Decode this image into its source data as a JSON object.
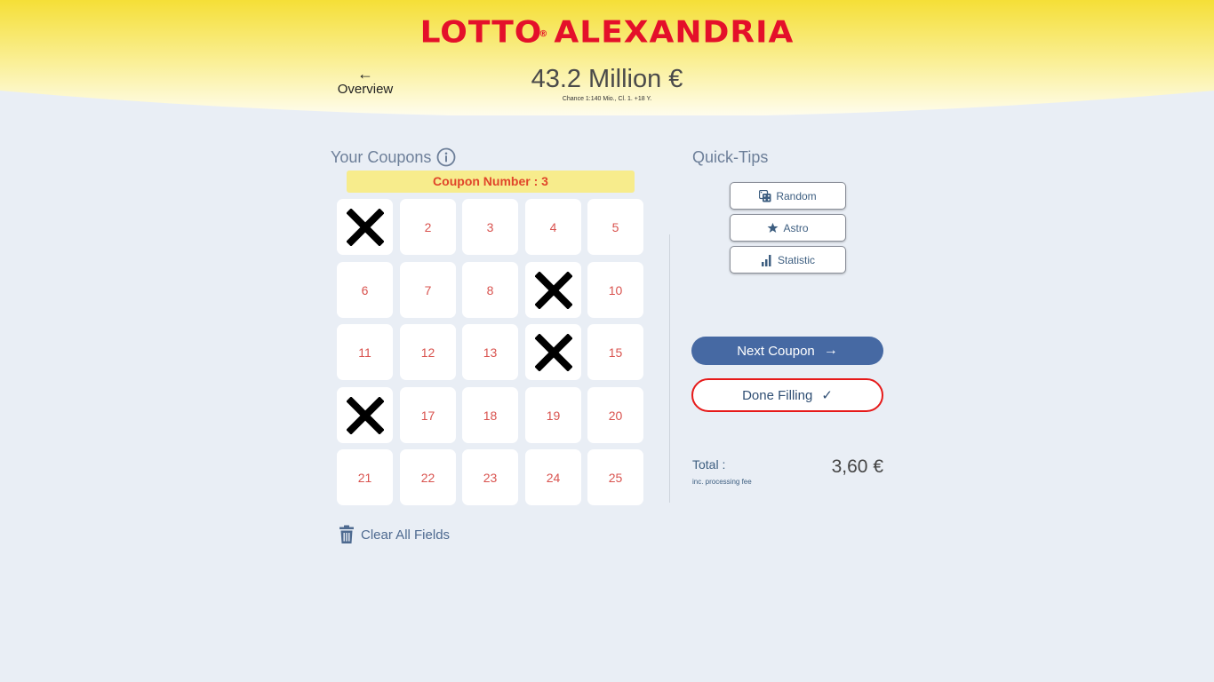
{
  "brand": {
    "logo_text": "LOTTO",
    "logo_text_2": "ALEXANDRIA",
    "logo_mark": "®",
    "logo_color": "#e4102a"
  },
  "nav": {
    "back_arrow": "←",
    "back_label": "Overview"
  },
  "jackpot": {
    "amount": "43.2 Million €",
    "subtitle": "Chance 1:140 Mio., Cl. 1. +18 Y."
  },
  "coupons": {
    "title": "Your Coupons",
    "banner": "Coupon Number : 3",
    "numbers": [
      "1",
      "2",
      "3",
      "4",
      "5",
      "6",
      "7",
      "8",
      "9",
      "10",
      "11",
      "12",
      "13",
      "14",
      "15",
      "16",
      "17",
      "18",
      "19",
      "20",
      "21",
      "22",
      "23",
      "24",
      "25"
    ],
    "selected": [
      1,
      9,
      14,
      16
    ],
    "clear_label": "Clear All Fields"
  },
  "quick_tips": {
    "title": "Quick-Tips",
    "buttons": [
      {
        "label": "Random",
        "icon": "dice-icon"
      },
      {
        "label": "Astro",
        "icon": "star-icon"
      },
      {
        "label": "Statistic",
        "icon": "bar-chart-icon"
      }
    ]
  },
  "actions": {
    "next_label": "Next Coupon",
    "next_arrow": "→",
    "done_label": "Done Filling",
    "done_check": "✓"
  },
  "summary": {
    "total_label": "Total :",
    "fee_note": "inc. processing fee",
    "total_value": "3,60 €"
  },
  "colors": {
    "header_yellow": "#f5e03a",
    "primary_blue": "#4669a3",
    "done_border": "#e61919",
    "number_red": "#d9534f",
    "banner_yellow": "#f7ec8c"
  }
}
